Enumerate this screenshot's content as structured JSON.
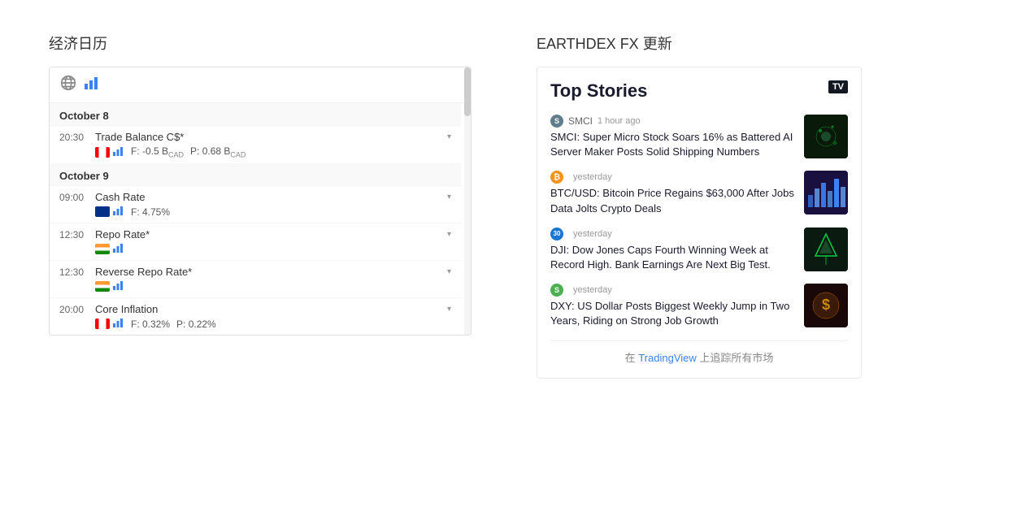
{
  "left": {
    "title": "经济日历",
    "dates": [
      {
        "label": "October 8",
        "events": [
          {
            "time": "20:30",
            "name": "Trade Balance C$*",
            "country": "ca",
            "forecast": "F: -0.5 B",
            "unit_f": "CAD",
            "prev": "P: 0.68 B",
            "unit_p": "CAD"
          }
        ]
      },
      {
        "label": "October 9",
        "events": [
          {
            "time": "09:00",
            "name": "Cash Rate",
            "country": "au",
            "forecast": "F: 4.75%",
            "prev": ""
          },
          {
            "time": "12:30",
            "name": "Repo Rate*",
            "country": "in",
            "forecast": "",
            "prev": ""
          },
          {
            "time": "12:30",
            "name": "Reverse Repo Rate*",
            "country": "in",
            "forecast": "",
            "prev": ""
          },
          {
            "time": "20:00",
            "name": "Core Inflation",
            "country": "ca",
            "forecast": "F: 0.32%",
            "prev": "P: 0.22%"
          }
        ]
      }
    ]
  },
  "right": {
    "title": "EARTHDEX FX 更新",
    "widget": {
      "heading": "Top Stories",
      "tv_logo": "TV",
      "items": [
        {
          "source": "SMCI",
          "badge_text": "S",
          "badge_class": "badge-smci",
          "time": "1 hour ago",
          "headline": "SMCI: Super Micro Stock Soars 16% as Battered AI Server Maker Posts Solid Shipping Numbers",
          "thumb_class": "thumb-smci"
        },
        {
          "source": "B",
          "badge_text": "B",
          "badge_class": "badge-btc",
          "time": "yesterday",
          "headline": "BTC/USD: Bitcoin Price Regains $63,000 After Jobs Data Jolts Crypto Deals",
          "thumb_class": "thumb-btc"
        },
        {
          "source": "30",
          "badge_text": "30",
          "badge_class": "badge-30",
          "time": "yesterday",
          "headline": "DJI: Dow Jones Caps Fourth Winning Week at Record High. Bank Earnings Are Next Big Test.",
          "thumb_class": "thumb-dji"
        },
        {
          "source": "S",
          "badge_text": "S",
          "badge_class": "badge-s",
          "time": "yesterday",
          "headline": "DXY: US Dollar Posts Biggest Weekly Jump in Two Years, Riding on Strong Job Growth",
          "thumb_class": "thumb-dxy"
        }
      ],
      "footer_text": "在 TradingView 上追踪所有市场",
      "footer_link": "TradingView"
    }
  }
}
